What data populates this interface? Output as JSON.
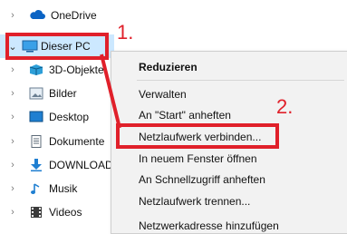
{
  "tree": {
    "onedrive": "OneDrive",
    "this_pc": "Dieser PC",
    "items": [
      "3D-Objekte",
      "Bilder",
      "Desktop",
      "Dokumente",
      "DOWNLOADS",
      "Musik",
      "Videos"
    ]
  },
  "menu": {
    "collapse": "Reduzieren",
    "manage": "Verwalten",
    "pin_start": "An \"Start\" anheften",
    "map_drive": "Netzlaufwerk verbinden...",
    "open_new_window": "In neuem Fenster öffnen",
    "pin_quick": "An Schnellzugriff anheften",
    "disconnect_drive": "Netzlaufwerk trennen...",
    "add_network_location": "Netzwerkadresse hinzufügen"
  },
  "annotations": {
    "step1": "1.",
    "step2": "2."
  },
  "colors": {
    "accent_red": "#e0202a",
    "selection": "#cce8ff"
  }
}
